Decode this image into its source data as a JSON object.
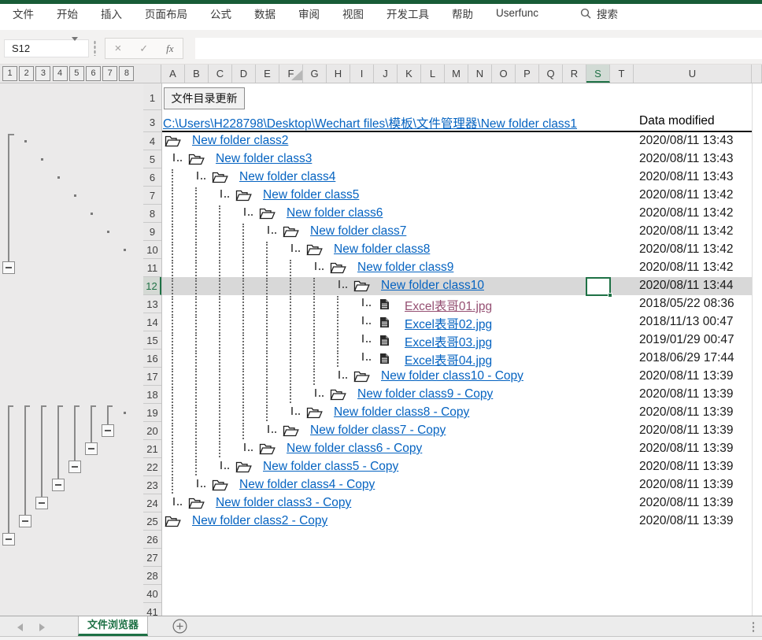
{
  "colors": {
    "titlebar_green": "#185C37",
    "accent_green": "#1E7145",
    "link_blue": "#0563C1",
    "link_visited": "#954F72",
    "row_highlight": "#D8D8D8"
  },
  "menu": {
    "tabs": [
      "文件",
      "开始",
      "插入",
      "页面布局",
      "公式",
      "数据",
      "审阅",
      "视图",
      "开发工具",
      "帮助",
      "Userfunc"
    ],
    "search": "搜索"
  },
  "formula_bar": {
    "name_box": "S12",
    "cancel_icon": "×",
    "enter_icon": "✓",
    "fx_label": "fx",
    "formula": ""
  },
  "outline": {
    "level_buttons": [
      "1",
      "2",
      "3",
      "4",
      "5",
      "6",
      "7",
      "8"
    ],
    "upper": {
      "line_level": 1,
      "from_row": 4,
      "minus_row": 11,
      "dots": [
        {
          "row": 4,
          "level": 2
        },
        {
          "row": 5,
          "level": 3
        },
        {
          "row": 6,
          "level": 4
        },
        {
          "row": 7,
          "level": 5
        },
        {
          "row": 8,
          "level": 6
        },
        {
          "row": 9,
          "level": 7
        },
        {
          "row": 10,
          "level": 8
        }
      ]
    },
    "lower": {
      "from_row": 19,
      "groups": [
        {
          "level": 1,
          "minus_row": 26
        },
        {
          "level": 2,
          "minus_row": 25
        },
        {
          "level": 3,
          "minus_row": 24
        },
        {
          "level": 4,
          "minus_row": 23
        },
        {
          "level": 5,
          "minus_row": 22
        },
        {
          "level": 6,
          "minus_row": 21
        },
        {
          "level": 7,
          "minus_row": 20
        }
      ],
      "dots": [
        {
          "row": 19,
          "level": 8
        }
      ]
    }
  },
  "grid": {
    "columns": [
      "A",
      "B",
      "C",
      "D",
      "E",
      "F",
      "G",
      "H",
      "I",
      "J",
      "K",
      "L",
      "M",
      "N",
      "O",
      "P",
      "Q",
      "R",
      "S",
      "T",
      "U"
    ],
    "selected_column": "S",
    "selected_cell": "S12",
    "selected_row": 12,
    "visible_rows": [
      1,
      3,
      4,
      5,
      6,
      7,
      8,
      9,
      10,
      11,
      12,
      13,
      14,
      15,
      16,
      17,
      18,
      19,
      20,
      21,
      22,
      23,
      24,
      25,
      26,
      27,
      28,
      40,
      41
    ],
    "update_button": "文件目录更新",
    "path_link": "C:\\Users\\H228798\\Desktop\\Wechart files\\模板\\文件管理器\\New folder class1",
    "date_header": "Data modified",
    "items": [
      {
        "row": 4,
        "level": 0,
        "kind": "folder",
        "name": "New folder class2",
        "date": "2020/08/11 13:43"
      },
      {
        "row": 5,
        "level": 1,
        "kind": "folder",
        "name": "New folder class3",
        "date": "2020/08/11 13:43"
      },
      {
        "row": 6,
        "level": 2,
        "kind": "folder",
        "name": "New folder class4",
        "date": "2020/08/11 13:43"
      },
      {
        "row": 7,
        "level": 3,
        "kind": "folder",
        "name": "New folder class5",
        "date": "2020/08/11 13:42"
      },
      {
        "row": 8,
        "level": 4,
        "kind": "folder",
        "name": "New folder class6",
        "date": "2020/08/11 13:42"
      },
      {
        "row": 9,
        "level": 5,
        "kind": "folder",
        "name": "New folder class7",
        "date": "2020/08/11 13:42"
      },
      {
        "row": 10,
        "level": 6,
        "kind": "folder",
        "name": "New folder class8",
        "date": "2020/08/11 13:42"
      },
      {
        "row": 11,
        "level": 7,
        "kind": "folder",
        "name": "New folder class9",
        "date": "2020/08/11 13:42"
      },
      {
        "row": 12,
        "level": 8,
        "kind": "folder",
        "name": "New folder class10",
        "date": "2020/08/11 13:44",
        "selected": true
      },
      {
        "row": 13,
        "level": 9,
        "kind": "file",
        "name": "Excel表哥01.jpg",
        "date": "2018/05/22 08:36",
        "visited": true
      },
      {
        "row": 14,
        "level": 9,
        "kind": "file",
        "name": "Excel表哥02.jpg",
        "date": "2018/11/13 00:47"
      },
      {
        "row": 15,
        "level": 9,
        "kind": "file",
        "name": "Excel表哥03.jpg",
        "date": "2019/01/29 00:47"
      },
      {
        "row": 16,
        "level": 9,
        "kind": "file",
        "name": "Excel表哥04.jpg",
        "date": "2018/06/29 17:44"
      },
      {
        "row": 17,
        "level": 8,
        "kind": "folder",
        "name": "New folder class10 - Copy",
        "date": "2020/08/11 13:39"
      },
      {
        "row": 18,
        "level": 7,
        "kind": "folder",
        "name": "New folder class9 - Copy",
        "date": "2020/08/11 13:39"
      },
      {
        "row": 19,
        "level": 6,
        "kind": "folder",
        "name": "New folder class8 - Copy",
        "date": "2020/08/11 13:39"
      },
      {
        "row": 20,
        "level": 5,
        "kind": "folder",
        "name": "New folder class7 - Copy",
        "date": "2020/08/11 13:39"
      },
      {
        "row": 21,
        "level": 4,
        "kind": "folder",
        "name": "New folder class6 - Copy",
        "date": "2020/08/11 13:39"
      },
      {
        "row": 22,
        "level": 3,
        "kind": "folder",
        "name": "New folder class5 - Copy",
        "date": "2020/08/11 13:39"
      },
      {
        "row": 23,
        "level": 2,
        "kind": "folder",
        "name": "New folder class4 - Copy",
        "date": "2020/08/11 13:39"
      },
      {
        "row": 24,
        "level": 1,
        "kind": "folder",
        "name": "New folder class3 - Copy",
        "date": "2020/08/11 13:39"
      },
      {
        "row": 25,
        "level": 0,
        "kind": "folder",
        "name": "New folder class2 - Copy",
        "date": "2020/08/11 13:39"
      }
    ]
  },
  "sheet_tabs": {
    "active": "文件浏览器"
  }
}
